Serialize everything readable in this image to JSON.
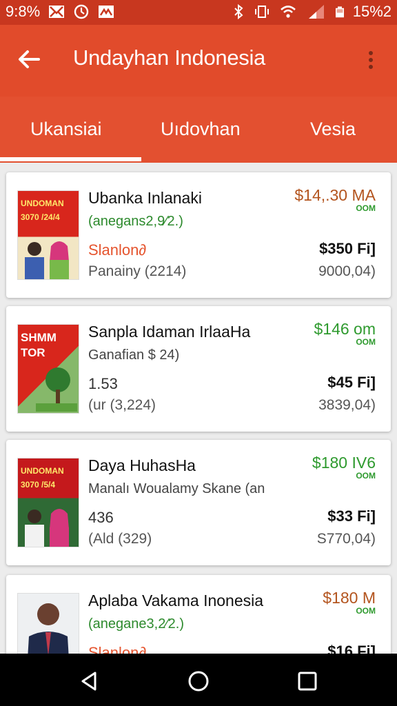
{
  "status_bar": {
    "time": "9:8%",
    "battery": "15%2"
  },
  "toolbar": {
    "title": "Undayhan Indonesia"
  },
  "tabs": [
    {
      "label": "Ukansiai",
      "selected": true
    },
    {
      "label": "Uıdovhan",
      "selected": false
    },
    {
      "label": "Vesia",
      "selected": false
    }
  ],
  "items": [
    {
      "thumb_text": "UNDOMAN 3070 /24/4",
      "title": "Ubanka Inlanaki",
      "subtitle": "(anegans2,9⁄2.)",
      "line3": "Slanlon∂",
      "line3_color": "#e5542e",
      "line4": "Panainy (2214)",
      "price": "$14,.30 MA",
      "price_sub": "OOM",
      "price_color": "#b3541e",
      "value": "$350 Fi]",
      "value2": "9000,04)"
    },
    {
      "thumb_text": "SHMM TOR",
      "title": "Sanpla Idaman IrlaaHa",
      "subtitle": "Ganafian $ 24)",
      "line3": "1.53",
      "line3_color": "#333333",
      "line4": "(ur (3,224)",
      "price": "$146 om",
      "price_sub": "OOM",
      "price_color": "#2e9a2e",
      "value": "$45 Fi]",
      "value2": "3839,04)"
    },
    {
      "thumb_text": "UNDOMAN 3070 /5/4",
      "title": "Daya HuhasHa",
      "subtitle": "Manalı Woualamy Skane (an",
      "line3": "436",
      "line3_color": "#333333",
      "line4": "(Ald (329)",
      "price": "$180 IV6",
      "price_sub": "OOM",
      "price_color": "#2e9a2e",
      "value": "$33 Fi]",
      "value2": "S770,04)"
    },
    {
      "thumb_text": "",
      "title": "Aplaba Vakama Inonesia",
      "subtitle": "(anegane3,2⁄2.)",
      "line3": "Slanlon∂",
      "line3_color": "#e5542e",
      "line4": "",
      "price": "$180 M",
      "price_sub": "OOM",
      "price_color": "#b3541e",
      "value": "$16 Fi]",
      "value2": ""
    }
  ],
  "icons": {
    "back": "arrow-left-icon",
    "overflow": "more-vert-icon",
    "nav_back": "triangle-back-icon",
    "nav_home": "circle-home-icon",
    "nav_recents": "square-recents-icon"
  },
  "colors": {
    "toolbar": "#e14b2b",
    "status": "#c8371f",
    "accent_green": "#2e9a2e"
  }
}
